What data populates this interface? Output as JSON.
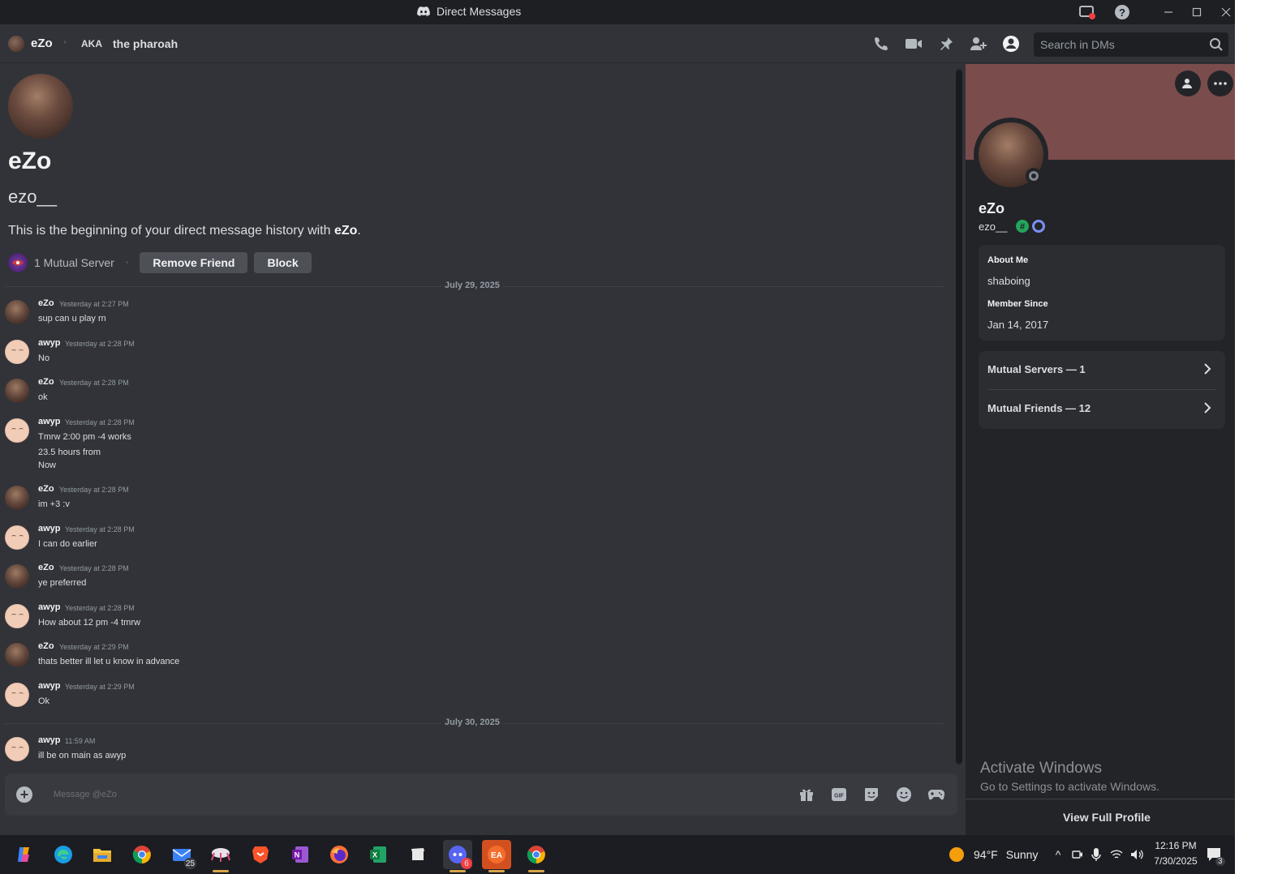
{
  "window": {
    "title": "Direct Messages"
  },
  "header": {
    "name": "eZo",
    "aka_label": "AKA",
    "nickname": "the pharoah",
    "search_placeholder": "Search in DMs"
  },
  "intro": {
    "display_name": "eZo",
    "username": "ezo__",
    "beginning_prefix": "This is the beginning of your direct message history with ",
    "beginning_name": "eZo",
    "beginning_suffix": ".",
    "mutual_server": "1 Mutual Server",
    "remove_friend": "Remove Friend",
    "block": "Block"
  },
  "dividers": [
    "July 29, 2025",
    "July 30, 2025"
  ],
  "messages": [
    {
      "author": "eZo",
      "time": "Yesterday at 2:27 PM",
      "lines": [
        "sup can u play rn"
      ]
    },
    {
      "author": "awyp",
      "time": "Yesterday at 2:28 PM",
      "lines": [
        "No"
      ]
    },
    {
      "author": "eZo",
      "time": "Yesterday at 2:28 PM",
      "lines": [
        "ok"
      ]
    },
    {
      "author": "awyp",
      "time": "Yesterday at 2:28 PM",
      "lines": [
        "Tmrw 2:00 pm -4 works",
        "23.5 hours from",
        "Now"
      ]
    },
    {
      "author": "eZo",
      "time": "Yesterday at 2:28 PM",
      "lines": [
        "im +3 :v"
      ]
    },
    {
      "author": "awyp",
      "time": "Yesterday at 2:28 PM",
      "lines": [
        "I can do earlier"
      ]
    },
    {
      "author": "eZo",
      "time": "Yesterday at 2:28 PM",
      "lines": [
        "ye preferred"
      ]
    },
    {
      "author": "awyp",
      "time": "Yesterday at 2:28 PM",
      "lines": [
        "How about 12 pm -4 tmrw"
      ]
    },
    {
      "author": "eZo",
      "time": "Yesterday at 2:29 PM",
      "lines": [
        "thats better ill let u know in advance"
      ]
    },
    {
      "author": "awyp",
      "time": "Yesterday at 2:29 PM",
      "lines": [
        "Ok"
      ]
    },
    {
      "author": "awyp",
      "time": "11:59 AM",
      "lines": [
        "ill be on main as awyp"
      ]
    }
  ],
  "composer": {
    "placeholder": "Message @eZo"
  },
  "profile": {
    "display_name": "eZo",
    "username": "ezo__",
    "about_label": "About Me",
    "about_value": "shaboing",
    "member_label": "Member Since",
    "member_value": "Jan 14, 2017",
    "mutual_servers": "Mutual Servers — 1",
    "mutual_friends": "Mutual Friends — 12",
    "view_full": "View Full Profile",
    "banner_color": "#7a4d4c"
  },
  "watermark": {
    "line1": "Activate Windows",
    "line2": "Go to Settings to activate Windows."
  },
  "taskbar": {
    "mail_badge": "25",
    "discord_badge": "6",
    "weather_temp": "94°F",
    "weather_text": "Sunny",
    "time": "12:16 PM",
    "date": "7/30/2025",
    "notif_count": "3"
  }
}
